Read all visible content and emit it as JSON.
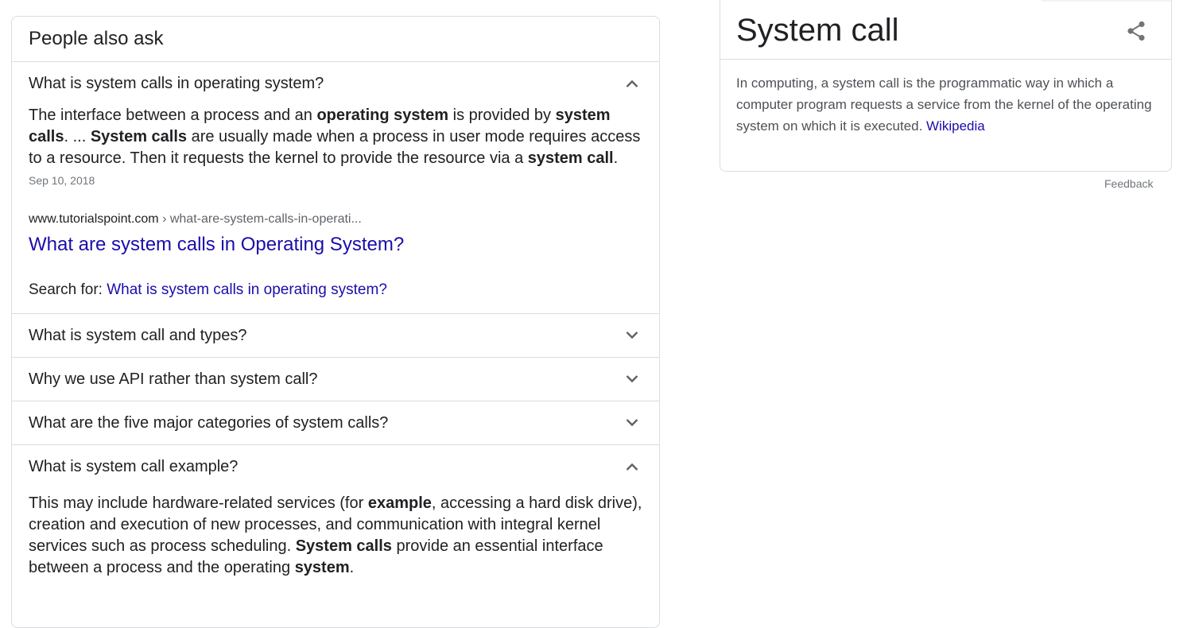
{
  "paa": {
    "title": "People also ask",
    "questions": [
      {
        "text": "What is system calls in operating system?",
        "expanded": true,
        "answer_parts": [
          {
            "t": "The interface between a process and an ",
            "b": false
          },
          {
            "t": "operating system",
            "b": true
          },
          {
            "t": " is provided by ",
            "b": false
          },
          {
            "t": "system calls",
            "b": true
          },
          {
            "t": ". ... ",
            "b": false
          },
          {
            "t": "System calls",
            "b": true
          },
          {
            "t": " are usually made when a process in user mode requires access to a resource. Then it requests the kernel to provide the resource via a ",
            "b": false
          },
          {
            "t": "system call",
            "b": true
          },
          {
            "t": ".",
            "b": false
          }
        ],
        "date": "Sep 10, 2018",
        "source_domain": "www.tutorialspoint.com",
        "source_path": " › what-are-system-calls-in-operati...",
        "source_title": "What are system calls in Operating System?",
        "search_for_label": "Search for: ",
        "search_for_link": "What is system calls in operating system?"
      },
      {
        "text": "What is system call and types?",
        "expanded": false
      },
      {
        "text": "Why we use API rather than system call?",
        "expanded": false
      },
      {
        "text": "What are the five major categories of system calls?",
        "expanded": false
      },
      {
        "text": "What is system call example?",
        "expanded": true,
        "answer_parts": [
          {
            "t": "This may include hardware-related services (for ",
            "b": false
          },
          {
            "t": "example",
            "b": true
          },
          {
            "t": ", accessing a hard disk drive), creation and execution of new processes, and communication with integral kernel services such as process scheduling. ",
            "b": false
          },
          {
            "t": "System calls",
            "b": true
          },
          {
            "t": " provide an essential interface between a process and the operating ",
            "b": false
          },
          {
            "t": "system",
            "b": true
          },
          {
            "t": ".",
            "b": false
          }
        ]
      }
    ]
  },
  "knowledge_panel": {
    "title": "System call",
    "description": "In computing, a system call is the programmatic way in which a computer program requests a service from the kernel of the operating system on which it is executed. ",
    "source_link": "Wikipedia",
    "share_icon": "share-icon",
    "feedback": "Feedback"
  },
  "colors": {
    "link": "#1a0dab",
    "text": "#202124",
    "secondary": "#70757a",
    "border": "#dadce0"
  }
}
